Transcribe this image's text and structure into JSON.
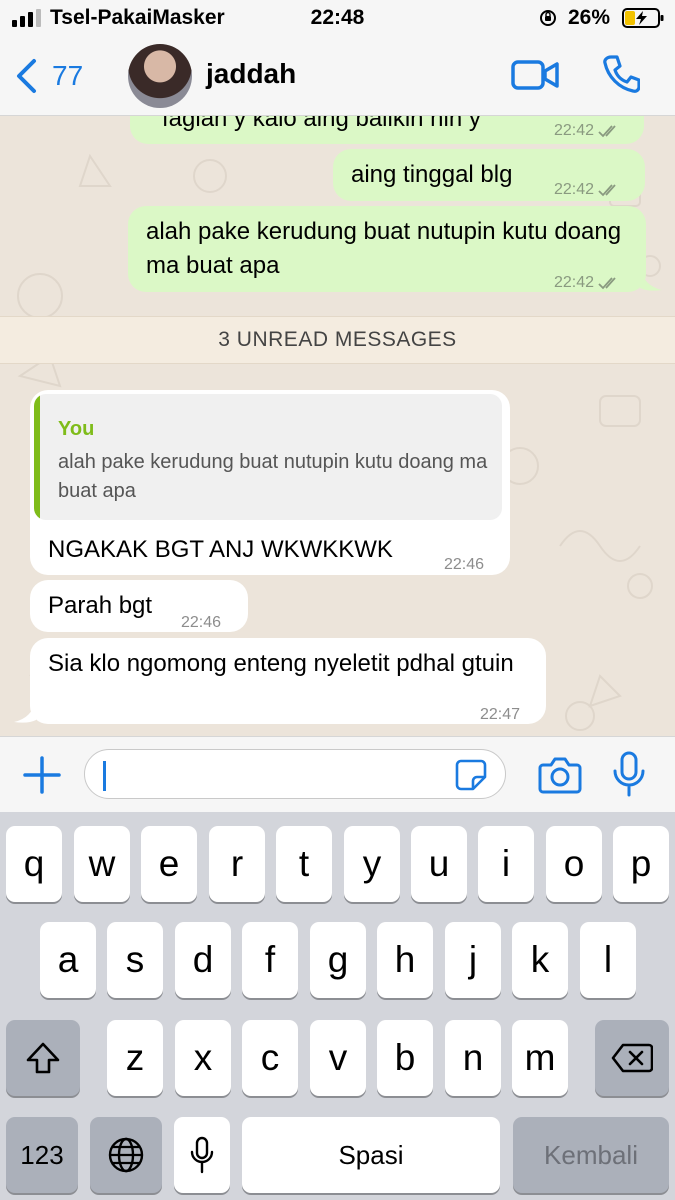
{
  "status_bar": {
    "carrier": "Tsel-PakaiMasker",
    "time": "22:48",
    "battery": "26%"
  },
  "header": {
    "back_count": "77",
    "contact_name": "jaddah"
  },
  "messages": [
    {
      "direction": "outgoing",
      "text": "fagiah y kalo aing balikin hin y",
      "time": "22:42"
    },
    {
      "direction": "outgoing",
      "text": "aing tinggal blg",
      "time": "22:42"
    },
    {
      "direction": "outgoing",
      "text": "alah pake kerudung buat nutupin kutu doang ma buat apa",
      "time": "22:42"
    },
    {
      "direction": "incoming",
      "quote_author": "You",
      "quote_text": "alah pake kerudung buat nutupin kutu doang ma buat apa",
      "text": "NGAKAK BGT ANJ WKWKKWK",
      "time": "22:46"
    },
    {
      "direction": "incoming",
      "text": "Parah bgt",
      "time": "22:46"
    },
    {
      "direction": "incoming",
      "text": "Sia klo ngomong enteng nyeletit pdhal gtuin",
      "time": "22:47"
    }
  ],
  "unread_banner": "3 UNREAD MESSAGES",
  "input": {
    "value": "",
    "placeholder": ""
  },
  "keyboard": {
    "row1": [
      "q",
      "w",
      "e",
      "r",
      "t",
      "y",
      "u",
      "i",
      "o",
      "p"
    ],
    "row2": [
      "a",
      "s",
      "d",
      "f",
      "g",
      "h",
      "j",
      "k",
      "l"
    ],
    "row3": [
      "z",
      "x",
      "c",
      "v",
      "b",
      "n",
      "m"
    ],
    "numbers_label": "123",
    "space_label": "Spasi",
    "return_label": "Kembali"
  },
  "colors": {
    "accent": "#1a7ae0",
    "outgoing_bubble": "#dbf8c6",
    "incoming_bubble": "#ffffff",
    "quote_author": "#7fbc1a",
    "chat_background": "#ece4da"
  },
  "icons": {
    "header": [
      "back-chevron-icon",
      "video-call-icon",
      "phone-call-icon"
    ],
    "input": [
      "plus-icon",
      "sticker-icon",
      "camera-icon",
      "microphone-icon"
    ],
    "keyboard": [
      "shift-icon",
      "backspace-icon",
      "globe-icon",
      "dictation-icon"
    ]
  }
}
